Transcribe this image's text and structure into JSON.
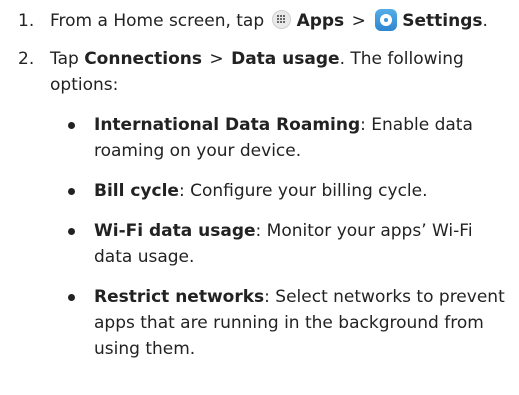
{
  "steps": [
    {
      "number": "1.",
      "prefix": "From a Home screen, tap ",
      "apps_label": "Apps",
      "separator": ">",
      "settings_label": "Settings",
      "suffix": "."
    },
    {
      "number": "2.",
      "prefix": "Tap ",
      "connections_label": "Connections",
      "separator": ">",
      "data_usage_label": "Data usage",
      "suffix": ". The following options:"
    }
  ],
  "options": [
    {
      "term": "International Data Roaming",
      "description": ": Enable data roaming on your device."
    },
    {
      "term": "Bill cycle",
      "description": ": Configure your billing cycle."
    },
    {
      "term": "Wi-Fi data usage",
      "description": ": Monitor your apps’ Wi-Fi data usage."
    },
    {
      "term": "Restrict networks",
      "description": ": Select networks to prevent apps that are running in the background from using them."
    }
  ],
  "icons": {
    "apps": "apps-grid-icon",
    "settings": "settings-gear-icon"
  },
  "colors": {
    "settings_icon": "#3b95d9",
    "text": "#222222"
  }
}
